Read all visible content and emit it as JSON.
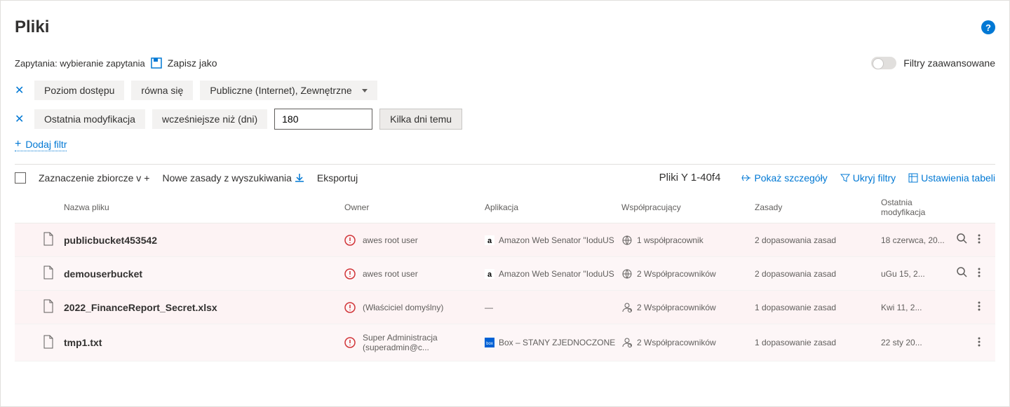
{
  "title": "Pliki",
  "queries_label": "Zapytania:",
  "queries_value": "wybieranie zapytania",
  "save_as": "Zapisz jako",
  "advanced_filters": "Filtry zaawansowane",
  "filters": [
    {
      "field": "Poziom dostępu",
      "operator": "równa się",
      "value": "Publiczne (Internet), Zewnętrzne"
    },
    {
      "field": "Ostatnia modyfikacja",
      "operator": "wcześniejsze niż (dni)",
      "input": "180",
      "pill": "Kilka dni temu"
    }
  ],
  "add_filter": "Dodaj filtr",
  "bulk_select": "Zaznaczenie zbiorcze v",
  "new_policy": "Nowe zasady z wyszukiwania",
  "export": "Eksportuj",
  "result_count": "Pliki Y 1-40f4",
  "show_details": "Pokaż szczegóły",
  "hide_filters": "Ukryj filtry",
  "table_settings": "Ustawienia tabeli",
  "columns": {
    "name": "Nazwa pliku",
    "owner": "Owner",
    "app": "Aplikacja",
    "collab": "Współpracujący",
    "policy": "Zasady",
    "mod": "Ostatnia modyfikacja"
  },
  "rows": [
    {
      "name": "publicbucket453542",
      "owner": "awes root user",
      "app": "Amazon Web Senator \"IoduUS",
      "app_icon": "aws",
      "collab": "1 współpracownik",
      "collab_icon": "globe",
      "policy": "2 dopasowania zasad",
      "mod": "18 czerwca, 20...",
      "search": true
    },
    {
      "name": "demouserbucket",
      "owner": "awes root user",
      "app": "Amazon Web Senator \"IoduUS",
      "app_icon": "aws",
      "collab": "2 Współpracowników",
      "collab_icon": "globe",
      "policy": "2 dopasowania zasad",
      "mod": "uGu 15, 2...",
      "search": true
    },
    {
      "name": "2022_FinanceReport_Secret.xlsx",
      "owner": "(Właściciel domyślny)",
      "app": "—",
      "app_icon": "none",
      "collab": "2 Współpracowników",
      "collab_icon": "person",
      "policy": "1 dopasowanie zasad",
      "mod": "Kwi 11, 2...",
      "search": false
    },
    {
      "name": "tmp1.txt",
      "owner": "Super Administracja (superadmin@c...",
      "app": "Box – STANY ZJEDNOCZONE",
      "app_icon": "box",
      "collab": "2 Współpracowników",
      "collab_icon": "person",
      "policy": "1 dopasowanie zasad",
      "mod": "22 sty 20...",
      "search": false
    }
  ]
}
